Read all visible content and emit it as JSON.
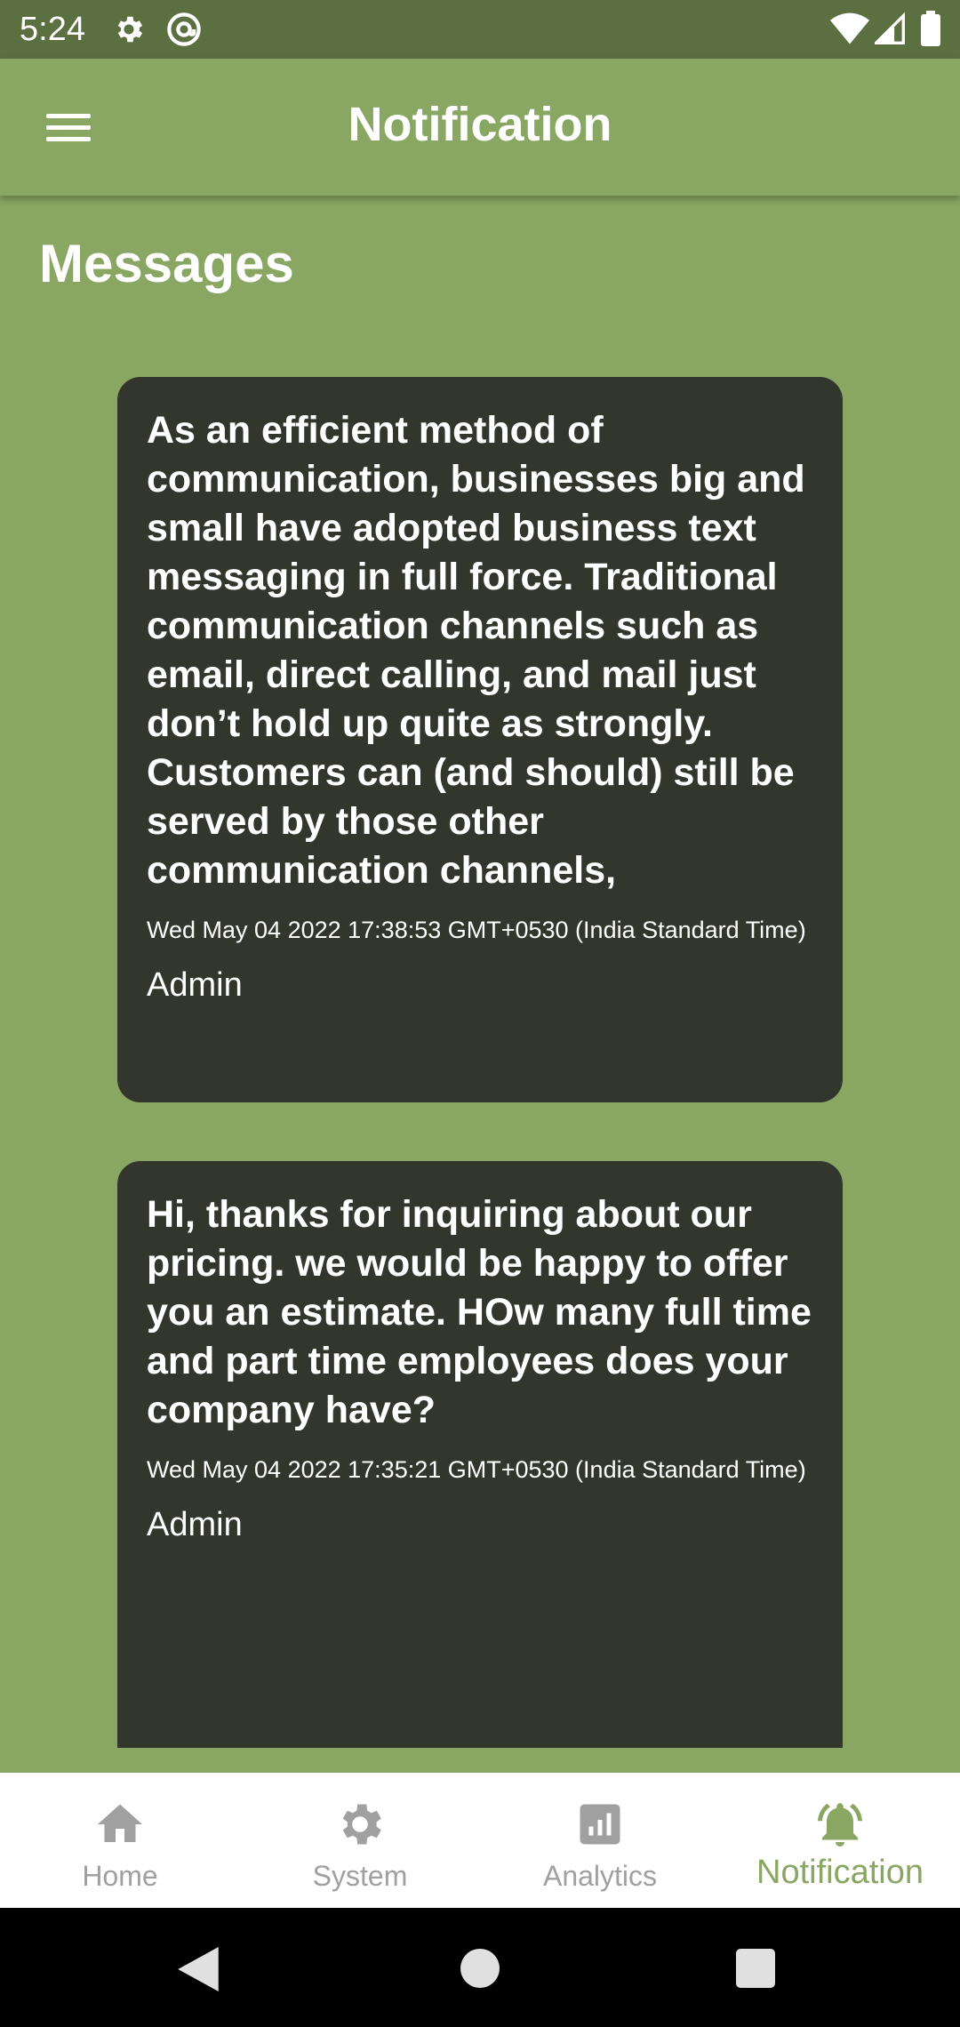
{
  "status_bar": {
    "time": "5:24",
    "icons": [
      "gear-icon",
      "at-sign-icon",
      "wifi-icon",
      "cell-signal-icon",
      "battery-icon"
    ]
  },
  "app_bar": {
    "title": "Notification",
    "menu_icon": "hamburger-menu-icon"
  },
  "section": {
    "title": "Messages"
  },
  "messages": [
    {
      "body": "As an efficient method of communication, businesses big and small have adopted business text messaging in full force. Traditional communication channels such as email, direct calling, and mail just don’t hold up quite as strongly. Customers can (and should) still be served by those other communication channels,",
      "timestamp": "Wed May 04 2022 17:38:53 GMT+0530 (India Standard Time)",
      "author": "Admin"
    },
    {
      "body": "Hi, thanks for inquiring about our pricing. we would be happy to offer you an estimate. HOw many full time and part time employees does your company have?",
      "timestamp": "Wed May 04 2022 17:35:21 GMT+0530 (India Standard Time)",
      "author": "Admin"
    }
  ],
  "bottom_nav": {
    "items": [
      {
        "label": "Home",
        "icon": "home-icon",
        "active": false
      },
      {
        "label": "System",
        "icon": "gear-icon",
        "active": false
      },
      {
        "label": "Analytics",
        "icon": "bar-chart-icon",
        "active": false
      },
      {
        "label": "Notification",
        "icon": "bell-icon",
        "active": true
      }
    ]
  },
  "colors": {
    "background": "#89a662",
    "status_bar": "#5b6f41",
    "card": "#32362d",
    "accent": "#89a662",
    "inactive_nav": "#a0a0a0"
  }
}
